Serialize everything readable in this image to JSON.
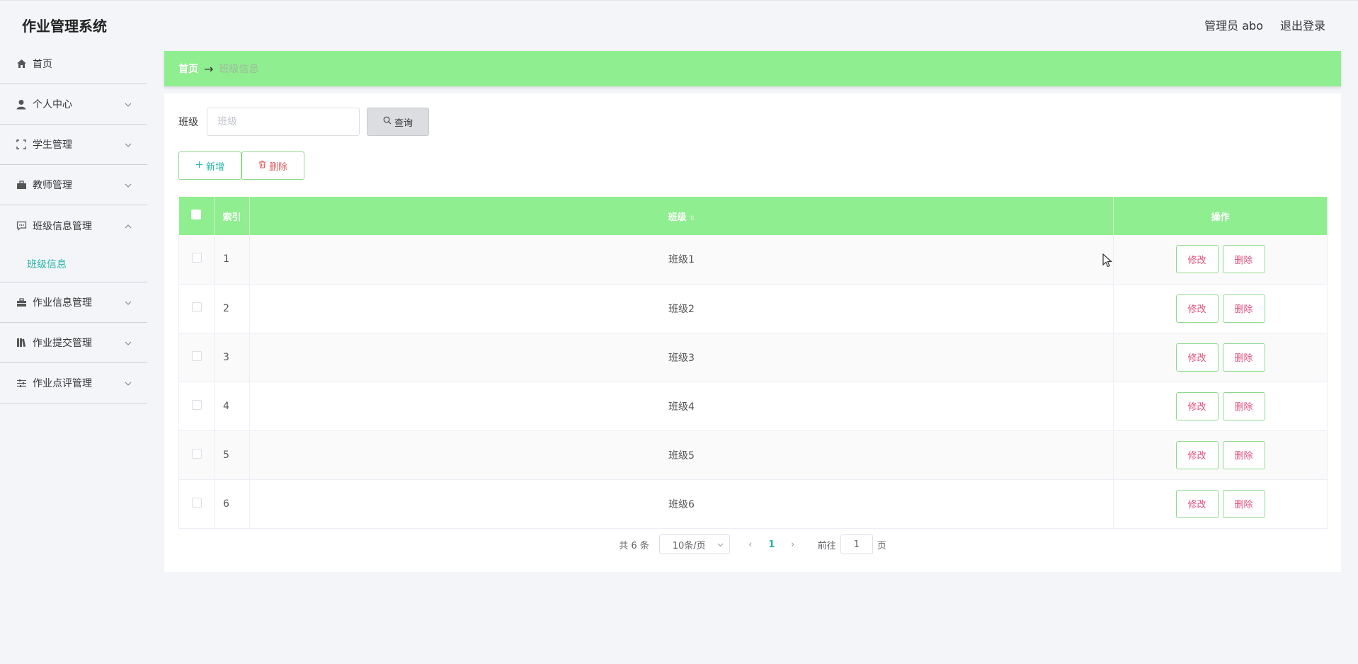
{
  "app": {
    "title": "作业管理系统"
  },
  "header": {
    "user_label": "管理员 abo",
    "logout_label": "退出登录"
  },
  "sidebar": {
    "items": [
      {
        "label": "首页",
        "icon": "home-icon"
      },
      {
        "label": "个人中心",
        "icon": "user-icon"
      },
      {
        "label": "学生管理",
        "icon": "scan-icon"
      },
      {
        "label": "教师管理",
        "icon": "briefcase-icon"
      },
      {
        "label": "班级信息管理",
        "icon": "message-icon"
      },
      {
        "label": "作业信息管理",
        "icon": "suitcase-icon"
      },
      {
        "label": "作业提交管理",
        "icon": "books-icon"
      },
      {
        "label": "作业点评管理",
        "icon": "sliders-icon"
      }
    ],
    "sub_active": "班级信息"
  },
  "breadcrumb": {
    "home": "首页",
    "current": "班级信息"
  },
  "search": {
    "label": "班级",
    "placeholder": "班级",
    "button": "查询"
  },
  "actions": {
    "add": "新增",
    "delete": "删除"
  },
  "table": {
    "headers": {
      "index": "索引",
      "class": "班级",
      "ops": "操作"
    },
    "edit_label": "修改",
    "delete_label": "删除",
    "rows": [
      {
        "index": "1",
        "class": "班级1"
      },
      {
        "index": "2",
        "class": "班级2"
      },
      {
        "index": "3",
        "class": "班级3"
      },
      {
        "index": "4",
        "class": "班级4"
      },
      {
        "index": "5",
        "class": "班级5"
      },
      {
        "index": "6",
        "class": "班级6"
      }
    ]
  },
  "pagination": {
    "total": "共 6 条",
    "page_size": "10条/页",
    "current_page": "1",
    "goto_prefix": "前往",
    "goto_value": "1",
    "goto_suffix": "页"
  },
  "colors": {
    "accent_green": "#8fee8f",
    "teal": "#26b5a6",
    "danger": "#e0507a"
  }
}
